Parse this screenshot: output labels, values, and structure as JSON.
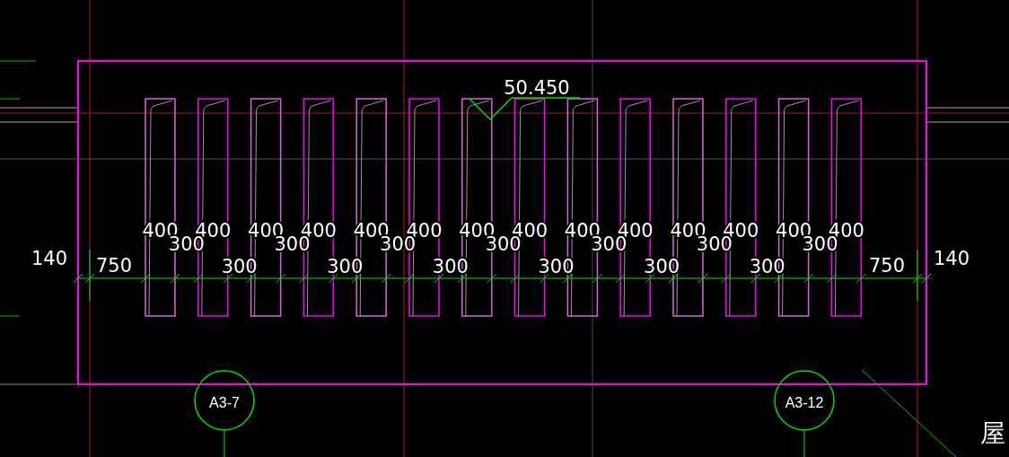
{
  "elevation": "50.450",
  "column_widths": [
    "400",
    "400",
    "400",
    "400",
    "400",
    "400",
    "400",
    "400",
    "400",
    "400",
    "400",
    "400",
    "400",
    "400"
  ],
  "gap_widths": [
    "300",
    "300",
    "300",
    "300",
    "300",
    "300",
    "300",
    "300",
    "300",
    "300",
    "300",
    "300",
    "300"
  ],
  "edge_dims": {
    "left_outer": "140",
    "left_end": "750",
    "right_end": "750",
    "right_outer": "140"
  },
  "grid_bubbles": [
    {
      "label": "A3-7"
    },
    {
      "label": "A3-12"
    }
  ],
  "side_text": "屋"
}
